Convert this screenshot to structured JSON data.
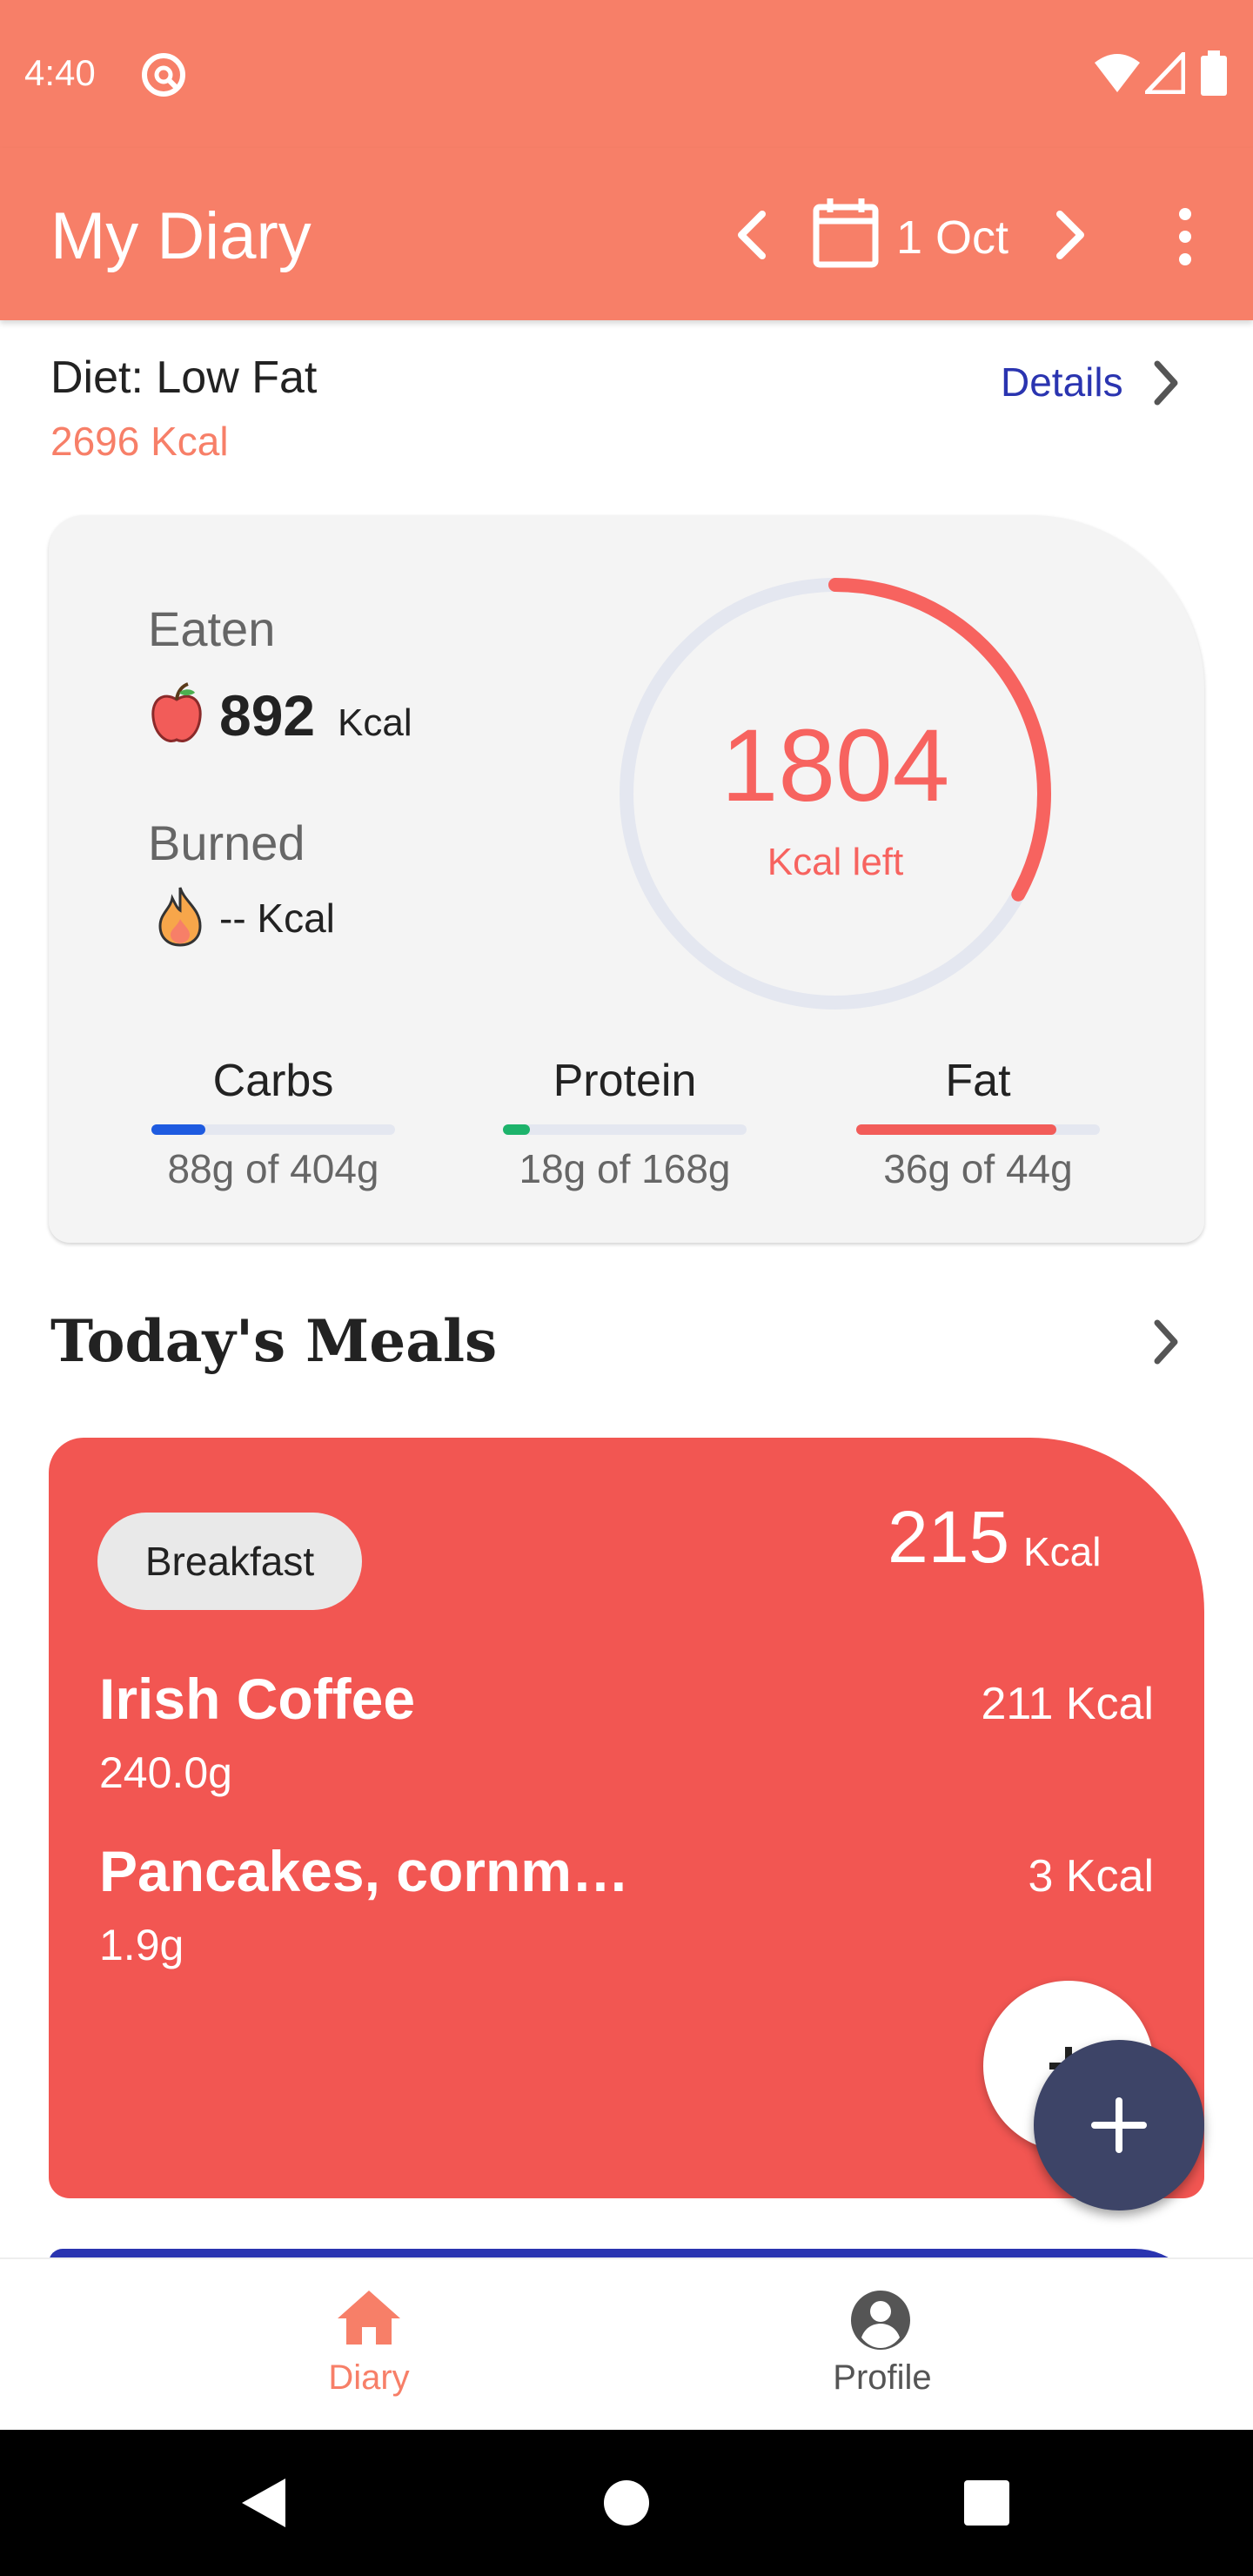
{
  "status_bar": {
    "time": "4:40"
  },
  "app_bar": {
    "title": "My Diary",
    "date": "1 Oct"
  },
  "diet": {
    "title": "Diet: Low Fat",
    "kcal": "2696 Kcal",
    "details_label": "Details"
  },
  "summary": {
    "eaten_label": "Eaten",
    "eaten_value": "892",
    "eaten_unit": "Kcal",
    "burned_label": "Burned",
    "burned_value": "-- Kcal",
    "kcal_left_value": "1804",
    "kcal_left_label": "Kcal left",
    "ring_fraction": 0.33,
    "macros": [
      {
        "name": "Carbs",
        "amount": "88g of 404g",
        "fraction": 0.22,
        "color": "#1E5BE0"
      },
      {
        "name": "Protein",
        "amount": "18g of 168g",
        "fraction": 0.11,
        "color": "#1DB36B"
      },
      {
        "name": "Fat",
        "amount": "36g of 44g",
        "fraction": 0.82,
        "color": "#F25C59"
      }
    ]
  },
  "meals": {
    "title": "Today's Meals",
    "card": {
      "type": "Breakfast",
      "total_value": "215",
      "total_unit": "Kcal",
      "items": [
        {
          "name": "Irish Coffee",
          "weight": "240.0g",
          "kcal": "211 Kcal"
        },
        {
          "name": "Pancakes, cornm…",
          "weight": "1.9g",
          "kcal": "3 Kcal"
        }
      ]
    }
  },
  "bottom_nav": {
    "items": [
      {
        "label": "Diary"
      },
      {
        "label": "Profile"
      }
    ]
  },
  "colors": {
    "accent": "#F77F68",
    "meal_card": "#F25652",
    "fab": "#3D4467",
    "link": "#2A34B0"
  }
}
